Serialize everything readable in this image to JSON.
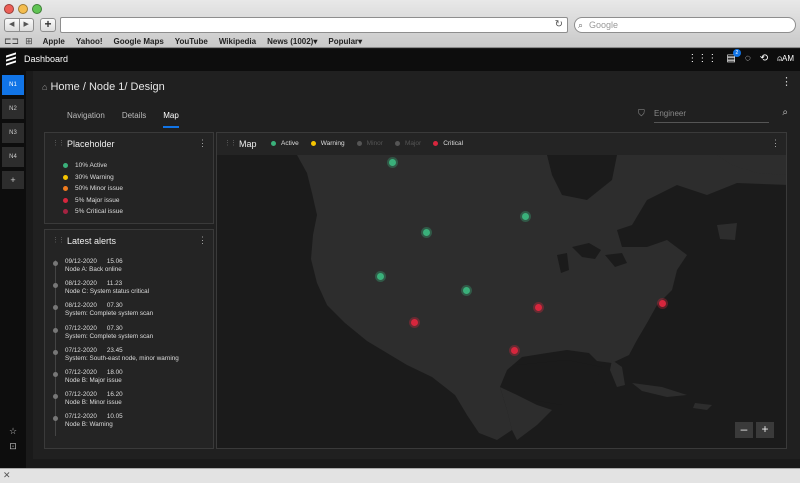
{
  "browser": {
    "search_placeholder": "Google",
    "bookmarks": [
      "Apple",
      "Yahoo!",
      "Google Maps",
      "YouTube",
      "Wikipedia",
      "News (1002)▾",
      "Popular▾"
    ]
  },
  "app": {
    "title": "Dashboard",
    "notification_count": "2",
    "user": "AM"
  },
  "sidebar": {
    "nodes": [
      "N1",
      "N2",
      "N3",
      "N4"
    ],
    "add_label": "+"
  },
  "page": {
    "breadcrumb": "Home / Node 1/ Design",
    "tabs": [
      "Navigation",
      "Details",
      "Map"
    ],
    "active_tab": "Map",
    "filter_placeholder": "Engineer"
  },
  "placeholder_card": {
    "title": "Placeholder",
    "items": [
      {
        "label": "10% Active",
        "color": "#3ab07a"
      },
      {
        "label": "30% Warning",
        "color": "#f5c400"
      },
      {
        "label": "50% Minor issue",
        "color": "#f07c1e"
      },
      {
        "label": "5% Major issue",
        "color": "#d7263d"
      },
      {
        "label": "5% Critical issue",
        "color": "#a42341"
      }
    ]
  },
  "alerts_card": {
    "title": "Latest alerts",
    "alerts": [
      {
        "date": "09/12-2020",
        "time": "15.06",
        "text": "Node A: Back online"
      },
      {
        "date": "08/12-2020",
        "time": "11.23",
        "text": "Node C: System status critical"
      },
      {
        "date": "08/12-2020",
        "time": "07.30",
        "text": "System: Complete system scan"
      },
      {
        "date": "07/12-2020",
        "time": "07.30",
        "text": "System: Complete system scan"
      },
      {
        "date": "07/12-2020",
        "time": "23.45",
        "text": "System: South-east node, minor warning"
      },
      {
        "date": "07/12-2020",
        "time": "18.00",
        "text": "Node B: Major issue"
      },
      {
        "date": "07/12-2020",
        "time": "16.20",
        "text": "Node B: Minor issue"
      },
      {
        "date": "07/12-2020",
        "time": "10.05",
        "text": "Node B: Warning"
      }
    ]
  },
  "map_card": {
    "title": "Map",
    "legend": [
      {
        "label": "Active",
        "color": "#3ab07a",
        "dim": false
      },
      {
        "label": "Warning",
        "color": "#f5c400",
        "dim": false
      },
      {
        "label": "Minor",
        "color": "#555555",
        "dim": true
      },
      {
        "label": "Major",
        "color": "#555555",
        "dim": true
      },
      {
        "label": "Critical",
        "color": "#d7263d",
        "dim": false
      }
    ],
    "zoom_out": "–",
    "zoom_in": "+"
  }
}
